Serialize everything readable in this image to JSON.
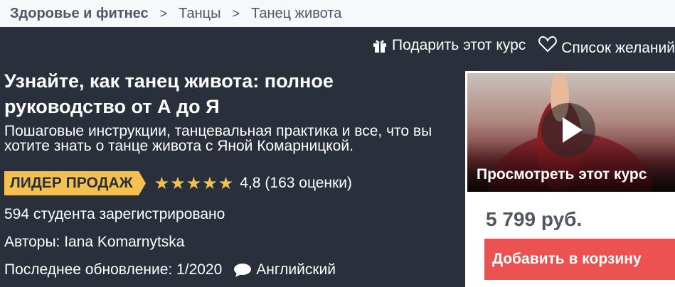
{
  "breadcrumb": {
    "items": [
      "Здоровье и фитнес",
      "Танцы",
      "Танец живота"
    ],
    "separator": ">"
  },
  "header": {
    "gift_label": "Подарить этот курс",
    "wishlist_label": "Список желаний"
  },
  "course": {
    "title": "Узнайте, как танец живота: полное руководство от А до Я",
    "subtitle": "Пошаговые инструкции, танцевальная практика и все, что вы хотите знать о танце живота с Яной Комарницкой.",
    "badge": "ЛИДЕР ПРОДАЖ",
    "rating_value": "4,8",
    "rating_count": "(163 оценки)",
    "stars": 5,
    "students": "594 студента зарегистрировано",
    "authors": "Авторы: Iana Komarnytska",
    "last_update": "Последнее обновление: 1/2020",
    "language": "Английский"
  },
  "sidebar_card": {
    "preview_label": "Просмотреть этот курс",
    "price": "5 799 руб.",
    "cart_button": "Добавить в корзину"
  },
  "colors": {
    "background": "#29303b",
    "badge": "#f4c150",
    "cart": "#ec5252",
    "breadcrumb_bg": "#f7f8fa"
  }
}
